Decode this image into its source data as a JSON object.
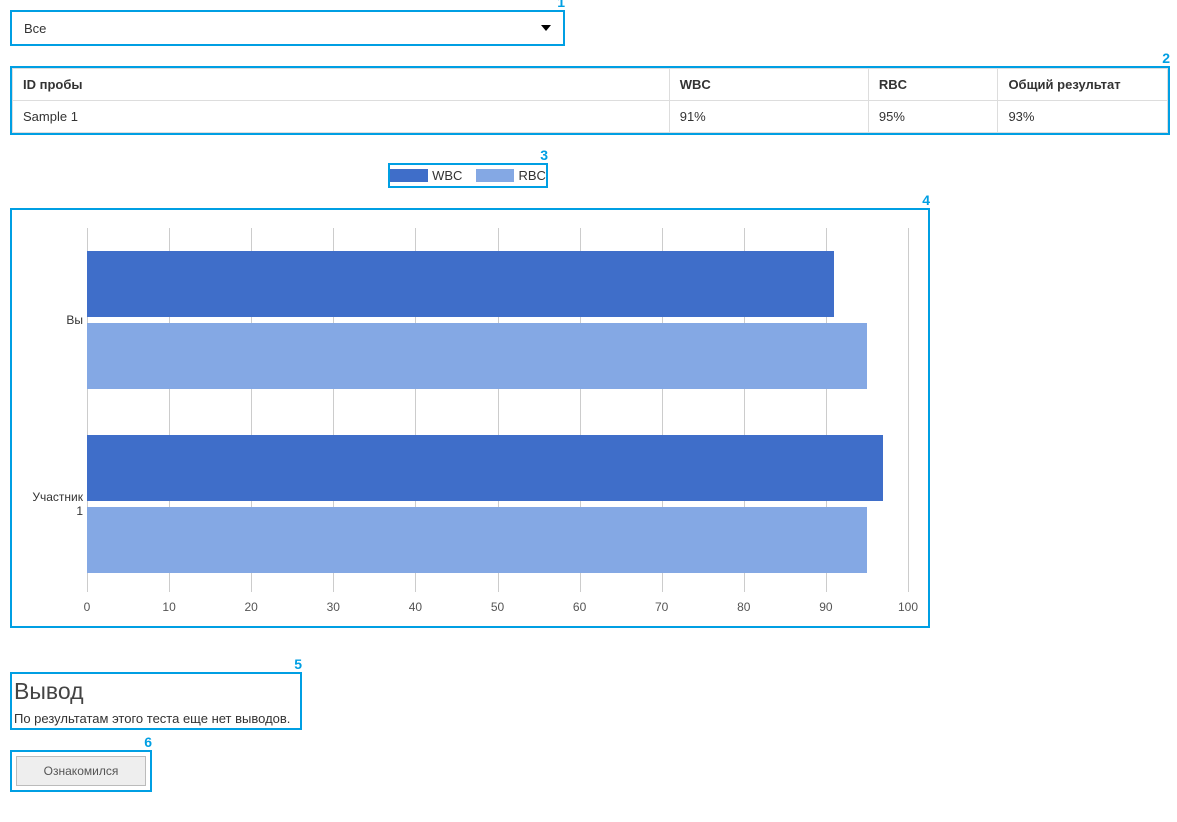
{
  "annotations": {
    "r1": "1",
    "r2": "2",
    "r3": "3",
    "r4": "4",
    "r5": "5",
    "r6": "6"
  },
  "dropdown": {
    "value": "Все"
  },
  "table": {
    "headers": {
      "id": "ID пробы",
      "wbc": "WBC",
      "rbc": "RBC",
      "total": "Общий результат"
    },
    "rows": [
      {
        "id": "Sample 1",
        "wbc": "91%",
        "rbc": "95%",
        "total": "93%"
      }
    ]
  },
  "legend": {
    "wbc": "WBC",
    "rbc": "RBC"
  },
  "chart_data": {
    "type": "bar",
    "orientation": "horizontal",
    "categories": [
      "Вы",
      "Участник 1"
    ],
    "series": [
      {
        "name": "WBC",
        "color": "#3f6ec9",
        "values": [
          91,
          97
        ]
      },
      {
        "name": "RBC",
        "color": "#84a8e4",
        "values": [
          95,
          95
        ]
      }
    ],
    "xlim": [
      0,
      100
    ],
    "xticks": [
      0,
      10,
      20,
      30,
      40,
      50,
      60,
      70,
      80,
      90,
      100
    ],
    "xlabel": "",
    "ylabel": "",
    "title": ""
  },
  "conclusion": {
    "heading": "Вывод",
    "text": "По результатам этого теста еще нет выводов."
  },
  "buttons": {
    "ack": "Ознакомился"
  }
}
